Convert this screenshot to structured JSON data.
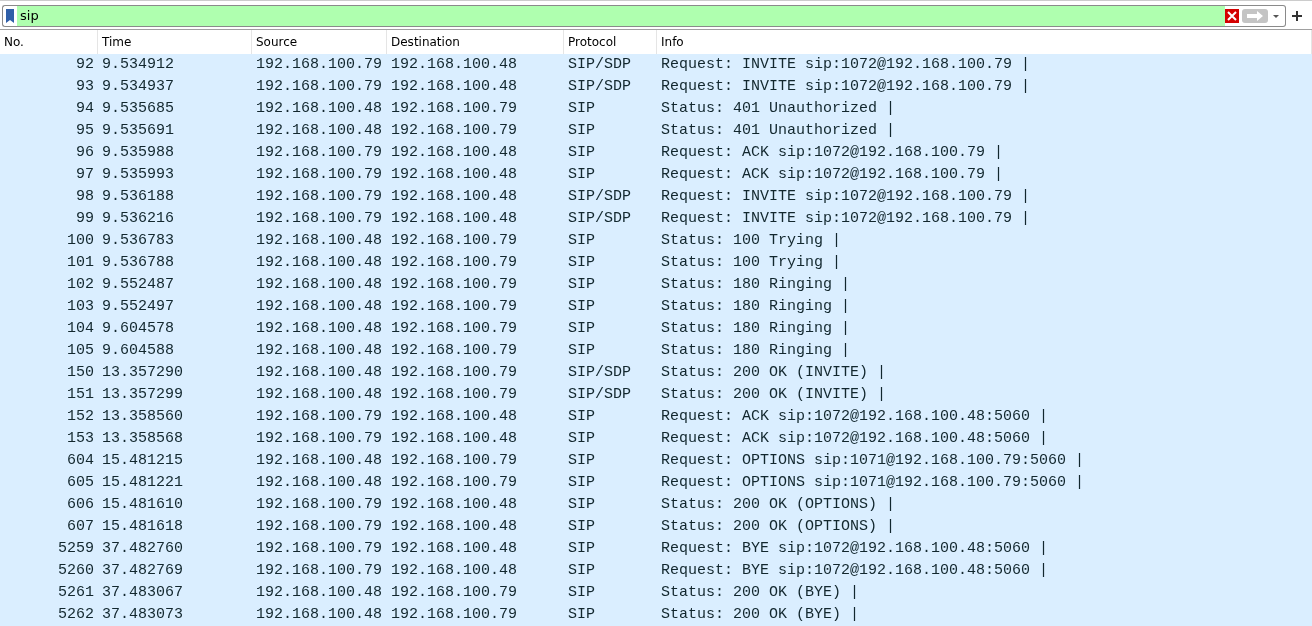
{
  "filter": {
    "value": "sip"
  },
  "table": {
    "columns": [
      "No.",
      "Time",
      "Source",
      "Destination",
      "Protocol",
      "Info"
    ],
    "rows": [
      [
        "92",
        "9.534912",
        "192.168.100.79",
        "192.168.100.48",
        "SIP/SDP",
        "Request: INVITE sip:1072@192.168.100.79 |"
      ],
      [
        "93",
        "9.534937",
        "192.168.100.79",
        "192.168.100.48",
        "SIP/SDP",
        "Request: INVITE sip:1072@192.168.100.79 |"
      ],
      [
        "94",
        "9.535685",
        "192.168.100.48",
        "192.168.100.79",
        "SIP",
        "Status: 401 Unauthorized |"
      ],
      [
        "95",
        "9.535691",
        "192.168.100.48",
        "192.168.100.79",
        "SIP",
        "Status: 401 Unauthorized |"
      ],
      [
        "96",
        "9.535988",
        "192.168.100.79",
        "192.168.100.48",
        "SIP",
        "Request: ACK sip:1072@192.168.100.79 |"
      ],
      [
        "97",
        "9.535993",
        "192.168.100.79",
        "192.168.100.48",
        "SIP",
        "Request: ACK sip:1072@192.168.100.79 |"
      ],
      [
        "98",
        "9.536188",
        "192.168.100.79",
        "192.168.100.48",
        "SIP/SDP",
        "Request: INVITE sip:1072@192.168.100.79 |"
      ],
      [
        "99",
        "9.536216",
        "192.168.100.79",
        "192.168.100.48",
        "SIP/SDP",
        "Request: INVITE sip:1072@192.168.100.79 |"
      ],
      [
        "100",
        "9.536783",
        "192.168.100.48",
        "192.168.100.79",
        "SIP",
        "Status: 100 Trying |"
      ],
      [
        "101",
        "9.536788",
        "192.168.100.48",
        "192.168.100.79",
        "SIP",
        "Status: 100 Trying |"
      ],
      [
        "102",
        "9.552487",
        "192.168.100.48",
        "192.168.100.79",
        "SIP",
        "Status: 180 Ringing |"
      ],
      [
        "103",
        "9.552497",
        "192.168.100.48",
        "192.168.100.79",
        "SIP",
        "Status: 180 Ringing |"
      ],
      [
        "104",
        "9.604578",
        "192.168.100.48",
        "192.168.100.79",
        "SIP",
        "Status: 180 Ringing |"
      ],
      [
        "105",
        "9.604588",
        "192.168.100.48",
        "192.168.100.79",
        "SIP",
        "Status: 180 Ringing |"
      ],
      [
        "150",
        "13.357290",
        "192.168.100.48",
        "192.168.100.79",
        "SIP/SDP",
        "Status: 200 OK (INVITE) |"
      ],
      [
        "151",
        "13.357299",
        "192.168.100.48",
        "192.168.100.79",
        "SIP/SDP",
        "Status: 200 OK (INVITE) |"
      ],
      [
        "152",
        "13.358560",
        "192.168.100.79",
        "192.168.100.48",
        "SIP",
        "Request: ACK sip:1072@192.168.100.48:5060 |"
      ],
      [
        "153",
        "13.358568",
        "192.168.100.79",
        "192.168.100.48",
        "SIP",
        "Request: ACK sip:1072@192.168.100.48:5060 |"
      ],
      [
        "604",
        "15.481215",
        "192.168.100.48",
        "192.168.100.79",
        "SIP",
        "Request: OPTIONS sip:1071@192.168.100.79:5060 |"
      ],
      [
        "605",
        "15.481221",
        "192.168.100.48",
        "192.168.100.79",
        "SIP",
        "Request: OPTIONS sip:1071@192.168.100.79:5060 |"
      ],
      [
        "606",
        "15.481610",
        "192.168.100.79",
        "192.168.100.48",
        "SIP",
        "Status: 200 OK (OPTIONS) |"
      ],
      [
        "607",
        "15.481618",
        "192.168.100.79",
        "192.168.100.48",
        "SIP",
        "Status: 200 OK (OPTIONS) |"
      ],
      [
        "5259",
        "37.482760",
        "192.168.100.79",
        "192.168.100.48",
        "SIP",
        "Request: BYE sip:1072@192.168.100.48:5060 |"
      ],
      [
        "5260",
        "37.482769",
        "192.168.100.79",
        "192.168.100.48",
        "SIP",
        "Request: BYE sip:1072@192.168.100.48:5060 |"
      ],
      [
        "5261",
        "37.483067",
        "192.168.100.48",
        "192.168.100.79",
        "SIP",
        "Status: 200 OK (BYE) |"
      ],
      [
        "5262",
        "37.483073",
        "192.168.100.48",
        "192.168.100.79",
        "SIP",
        "Status: 200 OK (BYE) |"
      ]
    ]
  }
}
